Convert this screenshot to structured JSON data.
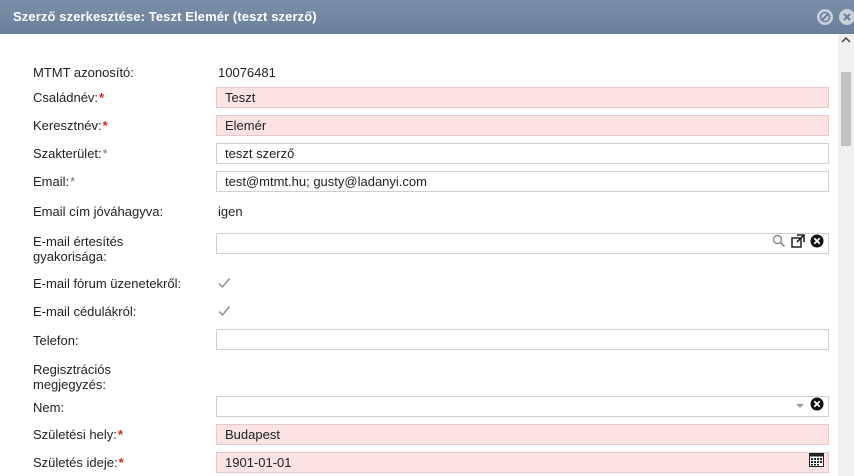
{
  "window": {
    "title": "Szerző szerkesztése: Teszt Elemér (teszt szerző)"
  },
  "form": {
    "mtmt_label": "MTMT azonosító:",
    "mtmt_value": "10076481",
    "family_label": "Családnév:",
    "family_value": "Teszt",
    "given_label": "Keresztnév:",
    "given_value": "Elemér",
    "field_label": "Szakterület:",
    "field_value": "teszt szerző",
    "email_label": "Email:",
    "email_value": "test@mtmt.hu; gusty@ladanyi.com",
    "email_approved_label": "Email cím jóváhagyva:",
    "email_approved_value": "igen",
    "email_freq_label_1": "E-mail értesítés",
    "email_freq_label_2": "gyakorisága:",
    "email_freq_value": "",
    "forum_label": "E-mail fórum üzenetekről:",
    "forum_checked": true,
    "notes_label": "E-mail cédulákról:",
    "notes_checked": true,
    "phone_label": "Telefon:",
    "phone_value": "",
    "reg_note_label_1": "Regisztrációs",
    "reg_note_label_2": "megjegyzés:",
    "gender_label": "Nem:",
    "gender_value": "",
    "birthplace_label": "Születési hely:",
    "birthplace_value": "Budapest",
    "birthdate_label": "Születés ideje:",
    "birthdate_value": "1901-01-01",
    "required_mark": "*"
  },
  "icons": {
    "search": "search-icon",
    "open": "open-external-icon",
    "clear": "clear-icon",
    "dropdown": "chevron-down-icon",
    "calendar": "calendar-icon",
    "check": "check-icon"
  },
  "colors": {
    "titlebar": "#6a7f9a",
    "invalid_bg": "#fbe3e4",
    "required": "#d9261c"
  }
}
